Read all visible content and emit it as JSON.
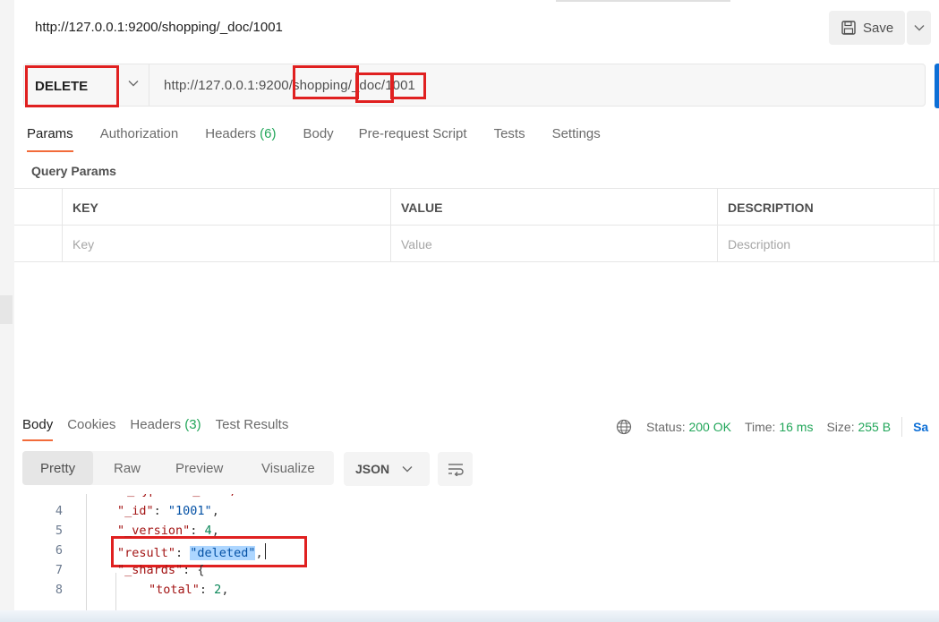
{
  "request": {
    "title": "http://127.0.0.1:9200/shopping/_doc/1001",
    "save_label": "Save",
    "method": "DELETE",
    "url": {
      "base": "http://127.0.0.1:9200",
      "seg_shopping": "shopping",
      "seg_doc": "_doc",
      "seg_id": "1001",
      "slash": "/"
    }
  },
  "tabs": {
    "params": "Params",
    "authorization": "Authorization",
    "headers": "Headers",
    "headers_count": "(6)",
    "body": "Body",
    "prerequest": "Pre-request Script",
    "tests": "Tests",
    "settings": "Settings"
  },
  "query_params": {
    "label": "Query Params",
    "columns": {
      "key": "KEY",
      "value": "VALUE",
      "description": "DESCRIPTION"
    },
    "placeholders": {
      "key": "Key",
      "value": "Value",
      "description": "Description"
    }
  },
  "response": {
    "tabs": {
      "body": "Body",
      "cookies": "Cookies",
      "headers": "Headers",
      "headers_count": "(3)",
      "test_results": "Test Results"
    },
    "status_label": "Status:",
    "status_value": "200 OK",
    "time_label": "Time:",
    "time_value": "16 ms",
    "size_label": "Size:",
    "size_value": "255 B",
    "save_partial": "Sa",
    "views": {
      "pretty": "Pretty",
      "raw": "Raw",
      "preview": "Preview",
      "visualize": "Visualize"
    },
    "format": "JSON",
    "code": {
      "l4": {
        "num": "4",
        "key": "\"_id\"",
        "val": "\"1001\""
      },
      "l5": {
        "num": "5",
        "key": "\"_version\"",
        "val": "4"
      },
      "l6": {
        "num": "6",
        "key": "\"result\"",
        "val": "\"deleted\""
      },
      "l7": {
        "num": "7",
        "key": "\"_shards\"",
        "brace": "{"
      },
      "l8": {
        "num": "8",
        "key": "\"total\"",
        "val": "2"
      }
    }
  },
  "colors": {
    "highlight": "#e02020",
    "accent_tab": "#f26b3a",
    "status_green": "#22a65a",
    "send_blue": "#0d6fd6"
  }
}
